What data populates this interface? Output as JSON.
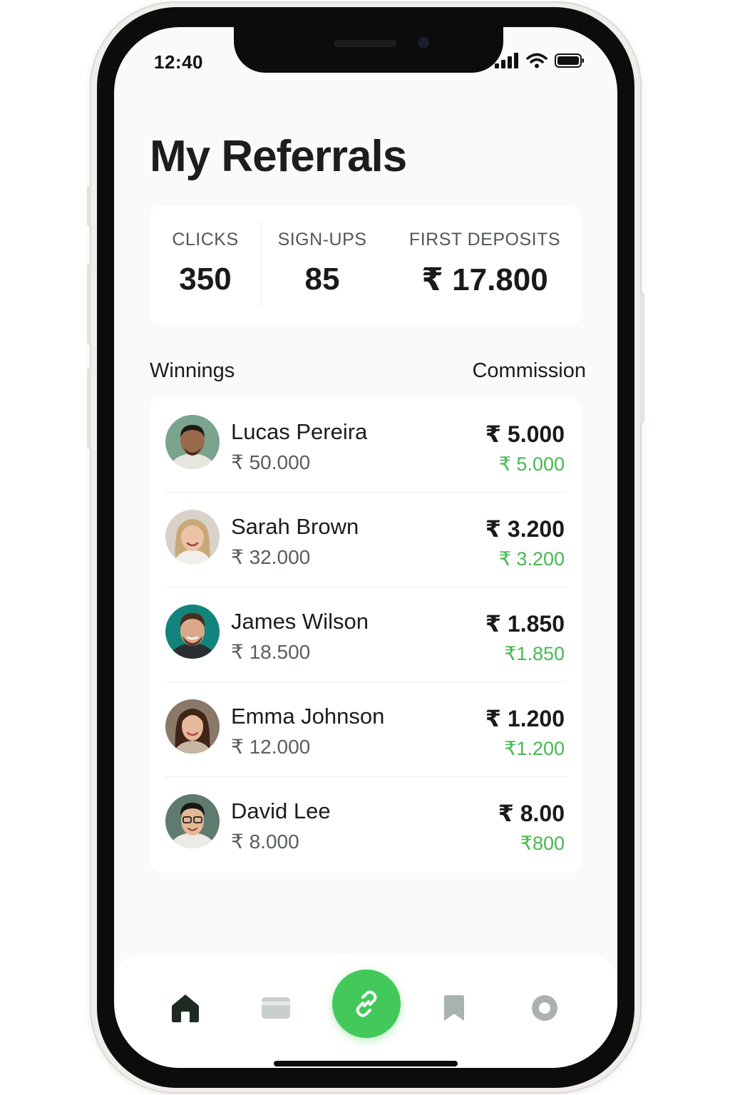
{
  "status_bar": {
    "time": "12:40",
    "signal_icon": "signal-bars-icon",
    "wifi_icon": "wifi-icon",
    "battery_icon": "battery-icon"
  },
  "page": {
    "title": "My Referrals"
  },
  "stats": [
    {
      "label": "CLICKS",
      "value": "350"
    },
    {
      "label": "SIGN-UPS",
      "value": "85"
    },
    {
      "label": "FIRST DEPOSITS",
      "value": "₹ 17.800"
    }
  ],
  "section": {
    "left_heading": "Winnings",
    "right_heading": "Commission"
  },
  "referrals": [
    {
      "name": "Lucas Pereira",
      "winnings": "₹ 50.000",
      "commission": "₹ 5.000",
      "commission_sub": "₹ 5.000"
    },
    {
      "name": "Sarah Brown",
      "winnings": "₹ 32.000",
      "commission": "₹ 3.200",
      "commission_sub": "₹ 3.200"
    },
    {
      "name": "James Wilson",
      "winnings": "₹ 18.500",
      "commission": "₹ 1.850",
      "commission_sub": "₹1.850"
    },
    {
      "name": "Emma Johnson",
      "winnings": "₹ 12.000",
      "commission": "₹ 1.200",
      "commission_sub": "₹1.200"
    },
    {
      "name": "David Lee",
      "winnings": "₹ 8.000",
      "commission": "₹ 8.00",
      "commission_sub": "₹800"
    }
  ],
  "nav": {
    "items": [
      {
        "icon": "home-icon"
      },
      {
        "icon": "card-icon"
      },
      {
        "icon": "link-icon"
      },
      {
        "icon": "bookmark-icon"
      },
      {
        "icon": "profile-icon"
      }
    ]
  },
  "colors": {
    "accent": "#43c95a",
    "commission_green": "#46b94e",
    "text_dark": "#1b1e1c"
  }
}
